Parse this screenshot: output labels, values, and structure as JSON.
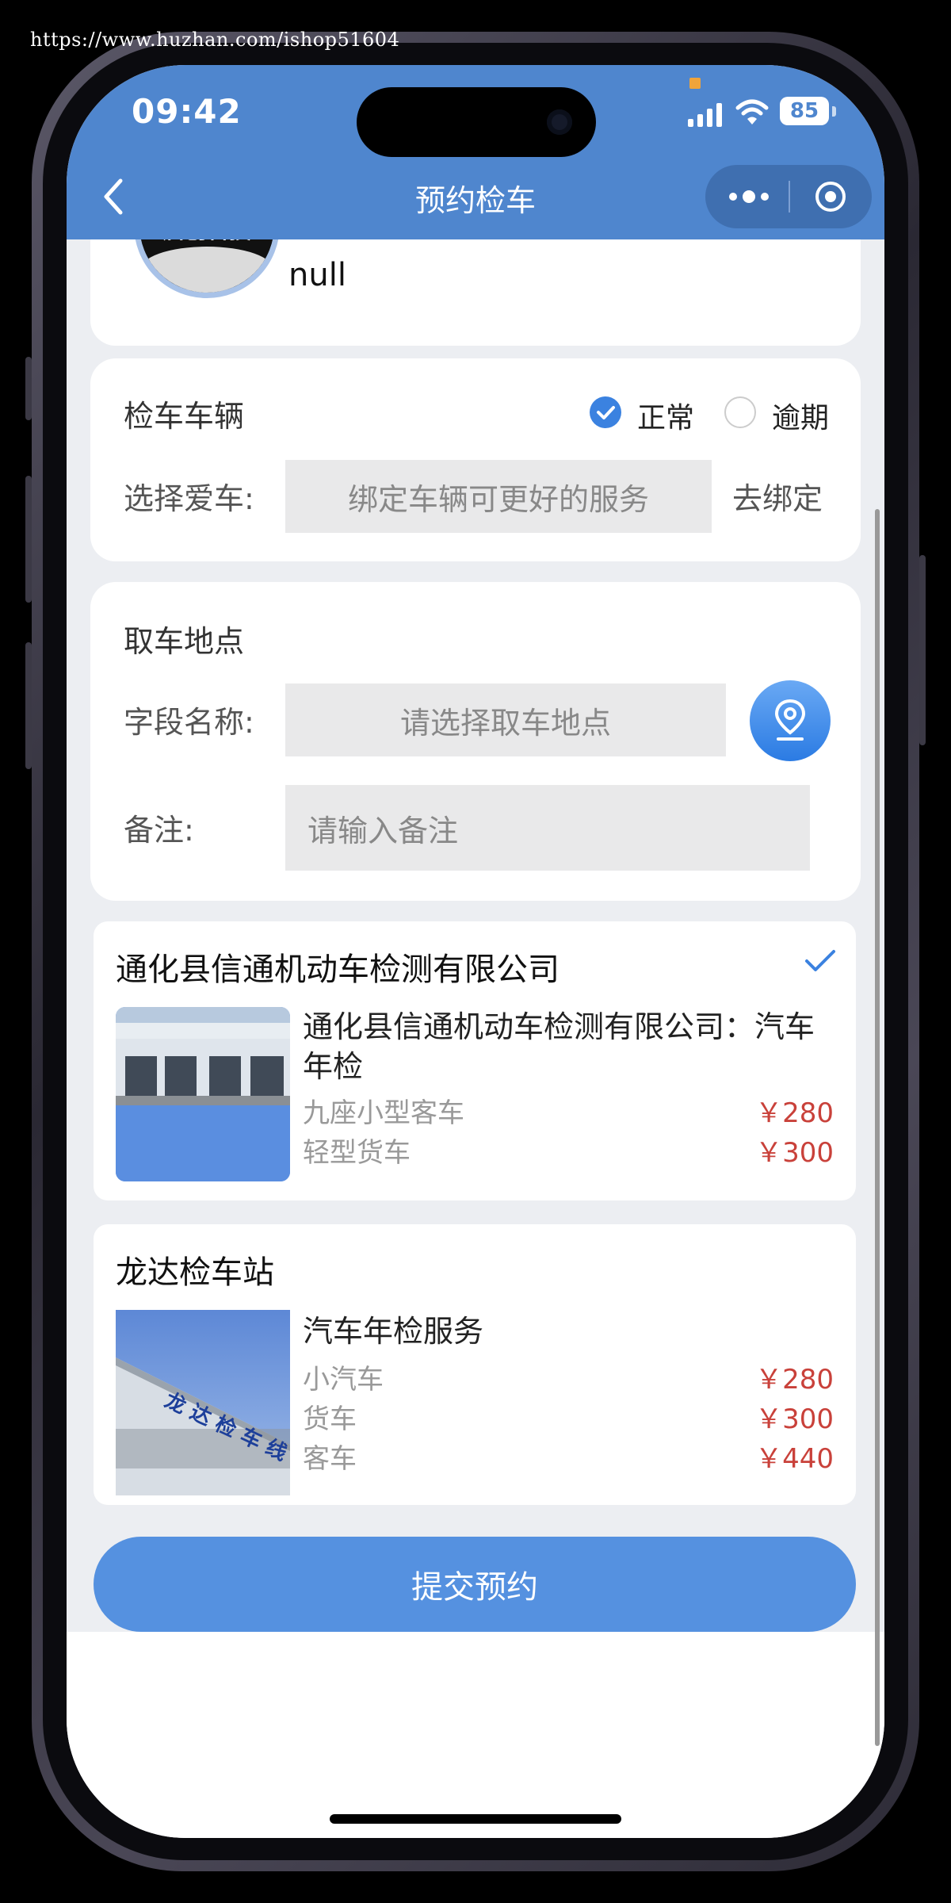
{
  "watermark": "https://www.huzhan.com/ishop51604",
  "status_bar": {
    "time": "09:42",
    "battery": "85"
  },
  "nav": {
    "title": "预约检车"
  },
  "profile": {
    "avatar_text": "启创科技",
    "name": "null"
  },
  "vehicle": {
    "title": "检车车辆",
    "status_options": [
      "正常",
      "逾期"
    ],
    "selected_status": "正常",
    "choose_label": "选择爱车:",
    "choose_placeholder": "绑定车辆可更好的服务",
    "bind_link": "去绑定"
  },
  "pickup": {
    "title": "取车地点",
    "field_label": "字段名称:",
    "field_placeholder": "请选择取车地点",
    "note_label": "备注:",
    "note_placeholder": "请输入备注"
  },
  "stations": [
    {
      "name": "通化县信通机动车检测有限公司",
      "selected": true,
      "item_title": "通化县信通机动车检测有限公司：汽车年检",
      "rows": [
        {
          "name": "九座小型客车",
          "price": "￥280"
        },
        {
          "name": "轻型货车",
          "price": "￥300"
        }
      ]
    },
    {
      "name": "龙达检车站",
      "selected": false,
      "item_title": "汽车年检服务",
      "rows": [
        {
          "name": "小汽车",
          "price": "￥280"
        },
        {
          "name": "货车",
          "price": "￥300"
        },
        {
          "name": "客车",
          "price": "￥440"
        }
      ]
    }
  ],
  "submit_label": "提交预约",
  "colors": {
    "header": "#4f86ce",
    "accent": "#3b82e0",
    "price": "#c9413a",
    "submit": "#5591e0"
  }
}
